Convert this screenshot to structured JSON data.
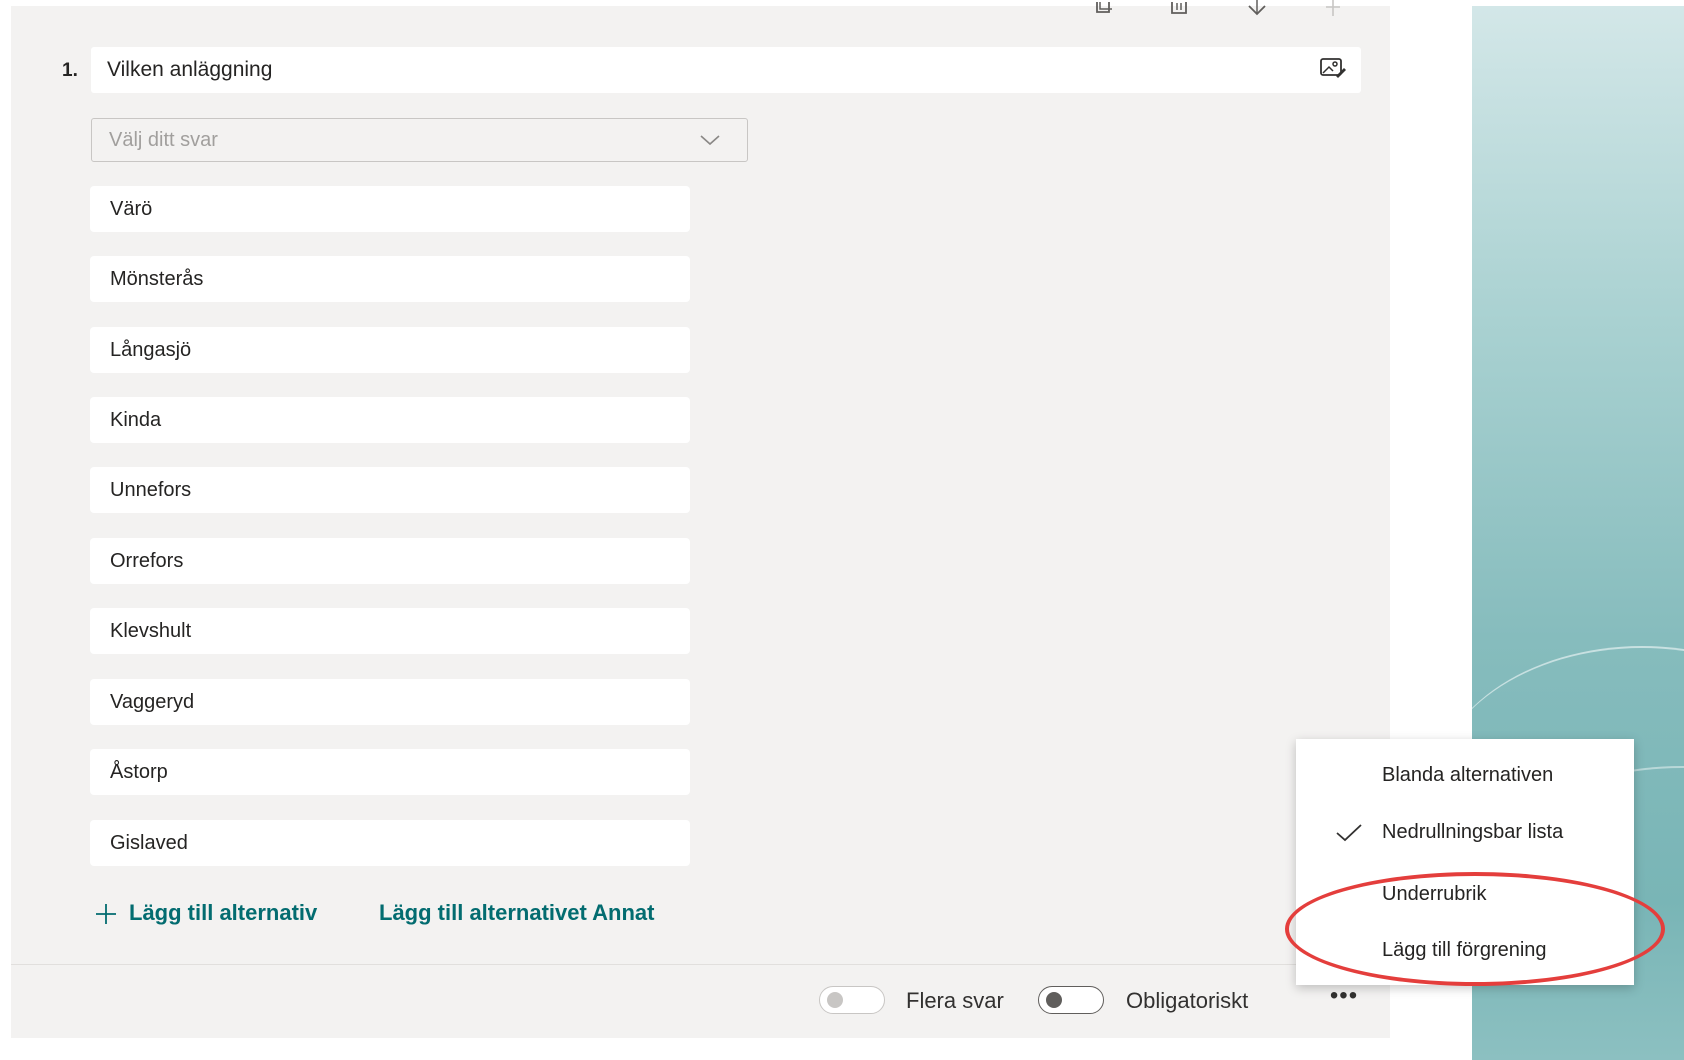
{
  "question": {
    "number": "1.",
    "title": "Vilken anläggning",
    "dropdown_placeholder": "Välj ditt svar",
    "options": [
      "Värö",
      "Mönsterås",
      "Långasjö",
      "Kinda",
      "Unnefors",
      "Orrefors",
      "Klevshult",
      "Vaggeryd",
      "Åstorp",
      "Gislaved"
    ]
  },
  "actions": {
    "add_option": "Lägg till alternativ",
    "add_other": "Lägg till alternativet Annat"
  },
  "footer": {
    "multiple_answers_label": "Flera svar",
    "required_label": "Obligatoriskt",
    "more_icon": "ellipsis-icon"
  },
  "menu": {
    "items": [
      {
        "label": "Blanda alternativen",
        "checked": false
      },
      {
        "label": "Nedrullningsbar lista",
        "checked": true
      },
      {
        "label": "Underrubrik",
        "checked": false
      },
      {
        "label": "Lägg till förgrening",
        "checked": false
      }
    ]
  },
  "toolbar": {
    "icons": [
      "copy-icon",
      "delete-icon",
      "move-down-icon",
      "move-up-icon"
    ]
  },
  "colors": {
    "accent": "#036c70",
    "highlight": "#e43e3c",
    "card_bg": "#f3f2f1"
  }
}
